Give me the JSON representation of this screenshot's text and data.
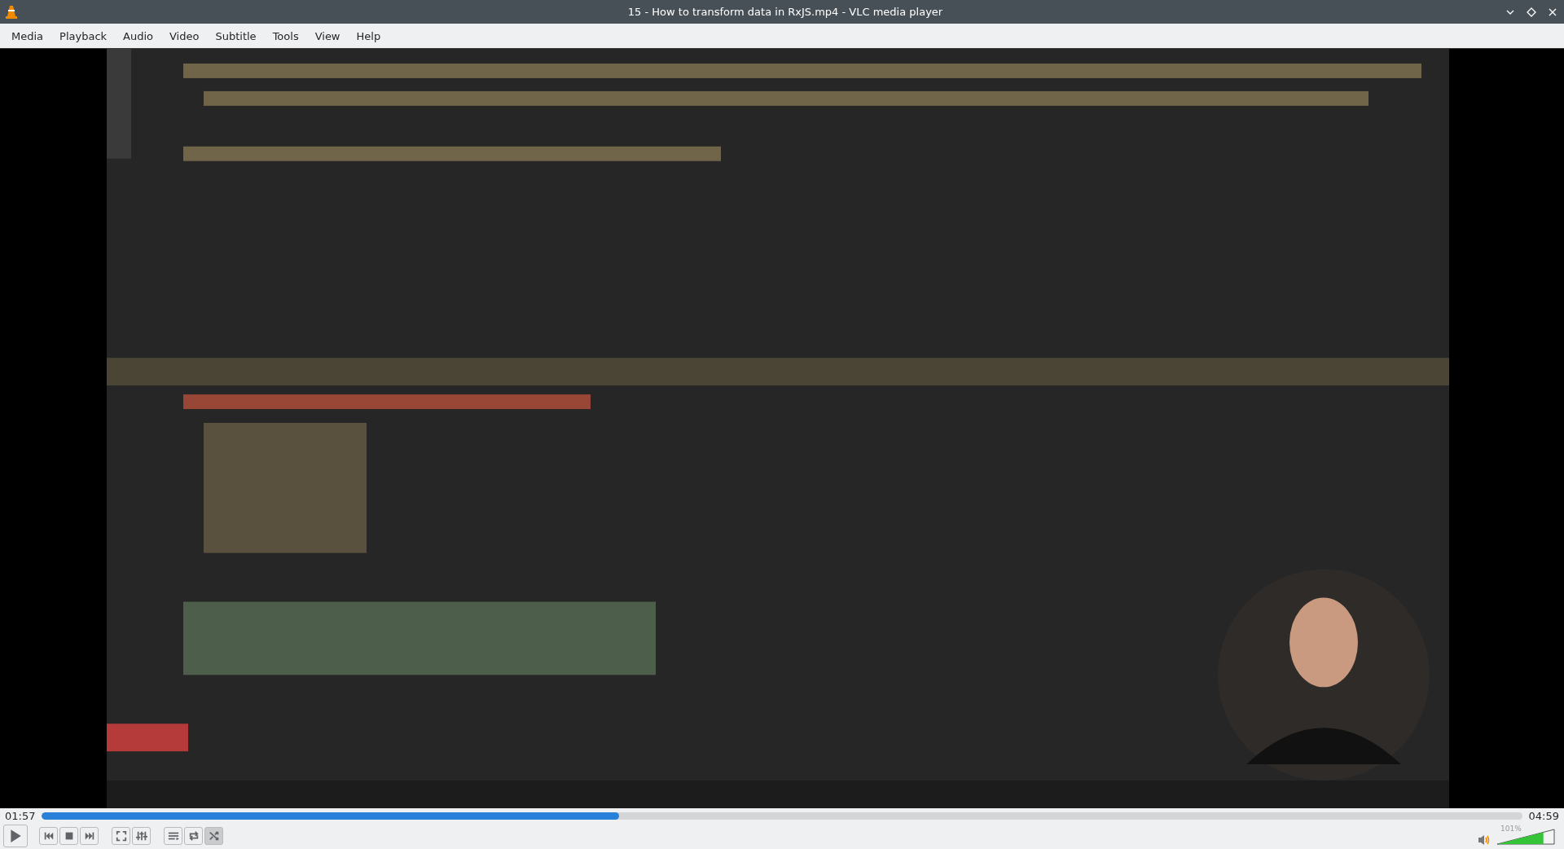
{
  "window": {
    "title": "15 - How to transform data in RxJS.mp4 - VLC media player"
  },
  "menu": [
    {
      "label": "Media"
    },
    {
      "label": "Playback"
    },
    {
      "label": "Audio"
    },
    {
      "label": "Video"
    },
    {
      "label": "Subtitle"
    },
    {
      "label": "Tools"
    },
    {
      "label": "View"
    },
    {
      "label": "Help"
    }
  ],
  "seek": {
    "elapsed": "01:57",
    "total": "04:59",
    "level": 0.39
  },
  "controls": [
    {
      "kind": "play",
      "on": false
    },
    {
      "kind": "prev",
      "on": false
    },
    {
      "kind": "stop",
      "on": false
    },
    {
      "kind": "next",
      "on": false
    },
    {
      "kind": "fullscreen",
      "on": false
    },
    {
      "kind": "effects",
      "on": false
    },
    {
      "kind": "playlist",
      "on": false
    },
    {
      "kind": "loop",
      "on": false
    },
    {
      "kind": "shuffle",
      "on": true
    }
  ],
  "volume": {
    "reading": "101%",
    "level": 0.81
  }
}
